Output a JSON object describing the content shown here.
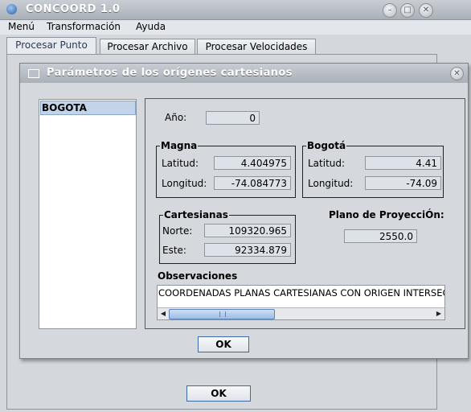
{
  "window": {
    "title": "CONCOORD 1.0",
    "minimize_icon": "minimize-icon",
    "maximize_icon": "maximize-icon",
    "close_icon": "close-icon"
  },
  "menubar": {
    "items": [
      "Menú",
      "Transformación",
      "Ayuda"
    ]
  },
  "tabs": [
    {
      "label": "Procesar Punto",
      "active": true
    },
    {
      "label": "Procesar Archivo",
      "active": false
    },
    {
      "label": "Procesar Velocidades",
      "active": false
    }
  ],
  "main": {
    "ok_label": "OK"
  },
  "dialog": {
    "title": "Parámetros de los orígenes cartesianos",
    "list_items": [
      "BOGOTA"
    ],
    "anio": {
      "label": "Año:",
      "value": "0"
    },
    "magna": {
      "title": "Magna",
      "latitud_label": "Latitud:",
      "latitud_value": "4.404975",
      "longitud_label": "Longitud:",
      "longitud_value": "-74.084773"
    },
    "bogota": {
      "title": "Bogotá",
      "latitud_label": "Latitud:",
      "latitud_value": "4.41",
      "longitud_label": "Longitud:",
      "longitud_value": "-74.09"
    },
    "cartesianas": {
      "title": "Cartesianas",
      "norte_label": "Norte:",
      "norte_value": "109320.965",
      "este_label": "Este:",
      "este_value": "92334.879"
    },
    "plano": {
      "label": "Plano de ProyecciÓn:",
      "value": "2550.0"
    },
    "observaciones": {
      "label": "Observaciones",
      "text": "COORDENADAS PLANAS CARTESIANAS CON ORIGEN INTERSECCION"
    },
    "ok_label": "OK"
  }
}
